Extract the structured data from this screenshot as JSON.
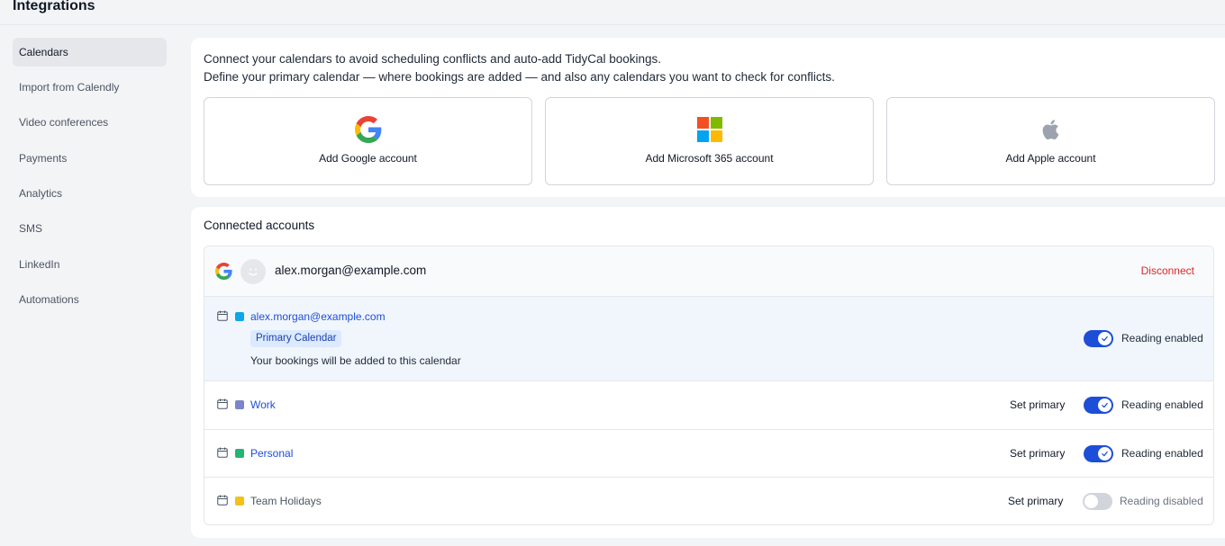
{
  "header": {
    "title": "Integrations"
  },
  "sidebar": {
    "items": [
      {
        "label": "Calendars",
        "active": true
      },
      {
        "label": "Import from Calendly",
        "active": false
      },
      {
        "label": "Video conferences",
        "active": false
      },
      {
        "label": "Payments",
        "active": false
      },
      {
        "label": "Analytics",
        "active": false
      },
      {
        "label": "SMS",
        "active": false
      },
      {
        "label": "LinkedIn",
        "active": false
      },
      {
        "label": "Automations",
        "active": false
      }
    ]
  },
  "connect": {
    "line1": "Connect your calendars to avoid scheduling conflicts and auto-add TidyCal bookings.",
    "line2": "Define your primary calendar — where bookings are added — and also any calendars you want to check for conflicts.",
    "providers": [
      {
        "label": "Add Google account",
        "icon": "google-logo-icon"
      },
      {
        "label": "Add Microsoft 365 account",
        "icon": "microsoft-logo-icon"
      },
      {
        "label": "Add Apple account",
        "icon": "apple-logo-icon"
      }
    ]
  },
  "connected": {
    "title": "Connected accounts",
    "account": {
      "provider_icon": "google-logo-icon",
      "email": "alex.morgan@example.com",
      "disconnect_label": "Disconnect"
    },
    "calendars": [
      {
        "name": "alex.morgan@example.com",
        "color": "#0ea5e9",
        "primary": true,
        "badge": "Primary Calendar",
        "note": "Your bookings will be added to this calendar",
        "reading_enabled": true,
        "reading_label": "Reading enabled"
      },
      {
        "name": "Work",
        "color": "#7c85c9",
        "primary": false,
        "set_primary_label": "Set primary",
        "reading_enabled": true,
        "reading_label": "Reading enabled"
      },
      {
        "name": "Personal",
        "color": "#22b573",
        "primary": false,
        "set_primary_label": "Set primary",
        "reading_enabled": true,
        "reading_label": "Reading enabled"
      },
      {
        "name": "Team Holidays",
        "color": "#f2c21b",
        "primary": false,
        "set_primary_label": "Set primary",
        "reading_enabled": false,
        "reading_label": "Reading disabled"
      }
    ]
  },
  "colors": {
    "accent": "#1d4ed8",
    "danger": "#dc2626",
    "primary_row_bg": "#f1f6fd"
  }
}
